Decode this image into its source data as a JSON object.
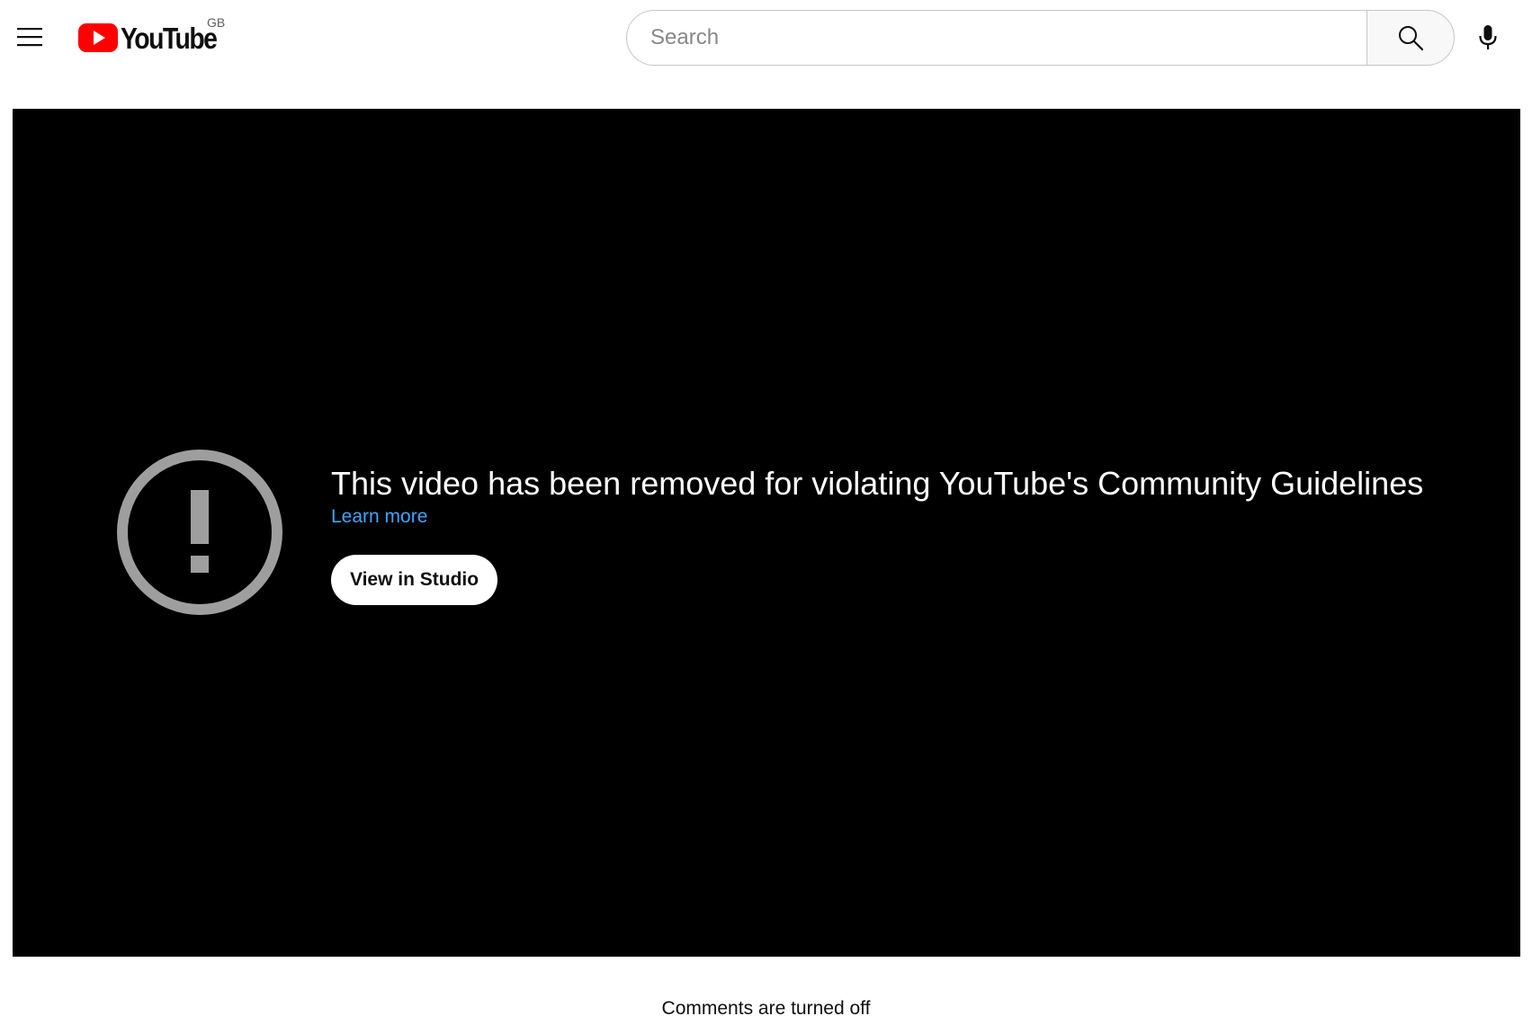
{
  "header": {
    "logo_text": "YouTube",
    "region": "GB",
    "search_placeholder": "Search",
    "icons": {
      "menu": "hamburger-menu-icon",
      "search": "search-icon",
      "mic": "microphone-icon",
      "logo": "youtube-play-logo-icon"
    }
  },
  "player": {
    "error_title": "This video has been removed for violating YouTube's Community Guidelines",
    "learn_more": "Learn more",
    "studio_button": "View in Studio",
    "icon": "alert-circle-icon"
  },
  "comments": {
    "status": "Comments are turned off"
  },
  "colors": {
    "brand_red": "#ff0000",
    "link_blue": "#3ea6ff",
    "player_bg": "#000000",
    "alert_icon": "#9e9e9e"
  }
}
